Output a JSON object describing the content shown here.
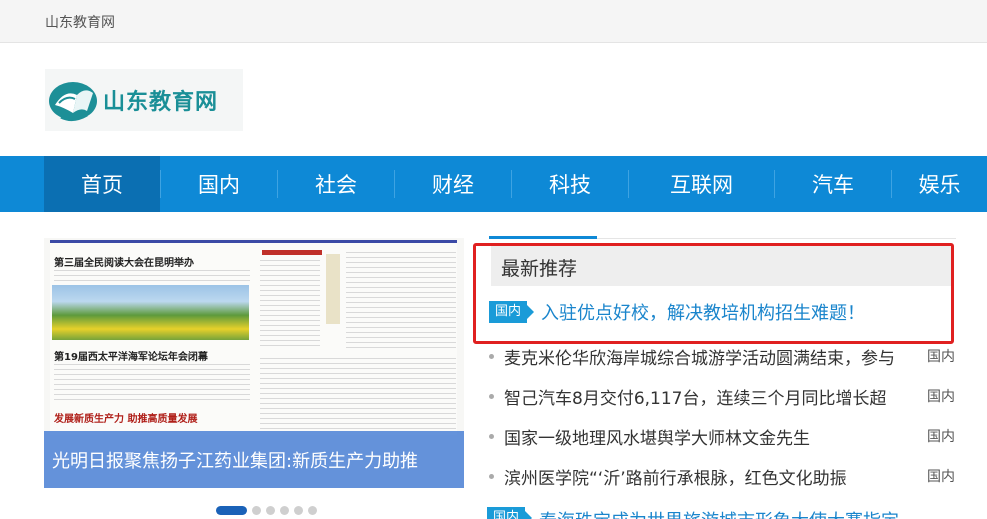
{
  "topbar": {
    "site_name": "山东教育网"
  },
  "logo": {
    "text": "山东教育网",
    "accent": "#1a8f97"
  },
  "nav": {
    "items": [
      {
        "label": "首页",
        "active": true
      },
      {
        "label": "国内"
      },
      {
        "label": "社会"
      },
      {
        "label": "财经"
      },
      {
        "label": "科技"
      },
      {
        "label": "互联网"
      },
      {
        "label": "汽车"
      },
      {
        "label": "娱乐"
      }
    ],
    "color": "#0e89d6"
  },
  "carousel": {
    "caption": "光明日报聚焦扬子江药业集团:新质生产力助推",
    "paper_headlines": [
      "第三届全民阅读大会在昆明举办",
      "第19届西太平洋海军论坛年会闭幕",
      "发展新质生产力  助推高质量发展"
    ],
    "slide_count": 6,
    "active_slide": 1
  },
  "recommend": {
    "heading": "最新推荐",
    "featured": {
      "tag": "国内",
      "title": "入驻优点好校，解决教培机构招生难题！"
    }
  },
  "news": [
    {
      "title": "麦克米伦华欣海岸城综合城游学活动圆满结束，参与",
      "category": "国内"
    },
    {
      "title": "智己汽车8月交付6,117台，连续三个月同比增长超",
      "category": "国内"
    },
    {
      "title": "国家一级地理风水堪舆学大师林文金先生",
      "category": "国内"
    },
    {
      "title": "滨州医学院“‘沂’路前行承根脉，红色文化助振",
      "category": "国内"
    }
  ],
  "partial_item": {
    "tag": "国内",
    "title": "泰海珠宝成为世界旅游城市形象大使大赛指定"
  }
}
